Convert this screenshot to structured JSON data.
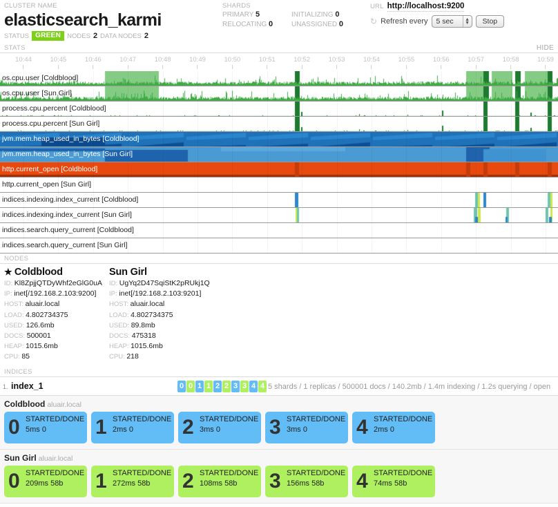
{
  "header": {
    "cluster_label": "CLUSTER NAME",
    "cluster_name": "elasticsearch_karmi",
    "status_label": "STATUS",
    "status_value": "GREEN",
    "status_color": "#7cd116",
    "nodes_label": "NODES",
    "nodes_value": "2",
    "data_nodes_label": "DATA NODES",
    "data_nodes_value": "2",
    "shards_label": "SHARDS",
    "shards": [
      {
        "label": "PRIMARY",
        "value": "5"
      },
      {
        "label": "INITIALIZING",
        "value": "0"
      },
      {
        "label": "RELOCATING",
        "value": "0"
      },
      {
        "label": "UNASSIGNED",
        "value": "0"
      }
    ],
    "url_label": "URL",
    "url_value": "http://localhost:9200",
    "refresh_icon": "refresh-icon",
    "refresh_label": "Refresh every",
    "refresh_interval": "5 sec",
    "stop_label": "Stop"
  },
  "stats": {
    "section_label": "STATS",
    "hide_label": "Hide",
    "ticks": [
      "10:44",
      "10:45",
      "10:46",
      "10:47",
      "10:48",
      "10:49",
      "10:50",
      "10:51",
      "10:52",
      "10:53",
      "10:54",
      "10:55",
      "10:56",
      "10:57",
      "10:58",
      "10:59"
    ],
    "rows": [
      {
        "label": "os.cpu.user [Coldblood]",
        "color": "#4eb24e",
        "style": "spike",
        "invert": false
      },
      {
        "label": "os.cpu.user [Sun Girl]",
        "color": "#4eb24e",
        "style": "spike",
        "invert": false
      },
      {
        "label": "process.cpu.percent [Coldblood]",
        "color": "#1d7a2f",
        "style": "sparse",
        "invert": false
      },
      {
        "label": "process.cpu.percent [Sun Girl]",
        "color": "#1d7a2f",
        "style": "sparse",
        "invert": false
      },
      {
        "label": "jvm.mem.heap_used_in_bytes [Coldblood]",
        "color": "#1f71b8",
        "style": "saw",
        "invert": true
      },
      {
        "label": "jvm.mem.heap_used_in_bytes [Sun Girl]",
        "color": "#4a9ad4",
        "style": "saw2",
        "invert": true
      },
      {
        "label": "http.current_open [Coldblood]",
        "color": "#e8490f",
        "style": "solid",
        "invert": true
      },
      {
        "label": "http.current_open [Sun Girl]",
        "color": "#e8490f",
        "style": "empty",
        "invert": false
      },
      {
        "label": "indices.indexing.index_current [Coldblood]",
        "color": "#2f86c8",
        "style": "ticks",
        "invert": false
      },
      {
        "label": "indices.indexing.index_current [Sun Girl]",
        "color": "#2f86c8",
        "style": "ticks2",
        "invert": false
      },
      {
        "label": "indices.search.query_current [Coldblood]",
        "color": "#2f86c8",
        "style": "empty",
        "invert": false
      },
      {
        "label": "indices.search.query_current [Sun Girl]",
        "color": "#2f86c8",
        "style": "empty",
        "invert": false
      }
    ]
  },
  "nodes": {
    "section_label": "NODES",
    "keys": [
      "ID",
      "IP",
      "HOST",
      "LOAD",
      "USED",
      "DOCS",
      "HEAP",
      "CPU"
    ],
    "list": [
      {
        "name": "Coldblood",
        "master": true,
        "master_icon": "star-icon",
        "values": [
          "Kl8ZpjjQTDyWhf2eGlG0uA",
          "inet[/192.168.2.103:9200]",
          "aluair.local",
          "4.802734375",
          "126.6mb",
          "500001",
          "1015.6mb",
          "85"
        ]
      },
      {
        "name": "Sun Girl",
        "master": false,
        "values": [
          "UgYq2D47SqiStK2pRUkj1Q",
          "inet[/192.168.2.103:9201]",
          "aluair.local",
          "4.802734375",
          "89.8mb",
          "475318",
          "1015.6mb",
          "218"
        ]
      }
    ]
  },
  "indices": {
    "section_label": "INDICES",
    "list": [
      {
        "number": "1.",
        "name": "index_1",
        "shard_badges": [
          {
            "label": "0",
            "color": "blue"
          },
          {
            "label": "0",
            "color": "green"
          },
          {
            "label": "1",
            "color": "blue"
          },
          {
            "label": "1",
            "color": "green"
          },
          {
            "label": "2",
            "color": "blue"
          },
          {
            "label": "2",
            "color": "green"
          },
          {
            "label": "3",
            "color": "blue"
          },
          {
            "label": "3",
            "color": "green"
          },
          {
            "label": "4",
            "color": "blue"
          },
          {
            "label": "4",
            "color": "green"
          }
        ],
        "meta": "5 shards / 1 replicas / 500001 docs / 140.2mb / 1.4m indexing / 1.2s querying / open"
      }
    ]
  },
  "shard_panels": [
    {
      "node": "Coldblood",
      "host": "aluair.local",
      "color": "blue",
      "cards": [
        {
          "num": "0",
          "state": "STARTED/DONE",
          "detail": "5ms 0"
        },
        {
          "num": "1",
          "state": "STARTED/DONE",
          "detail": "2ms 0"
        },
        {
          "num": "2",
          "state": "STARTED/DONE",
          "detail": "3ms 0"
        },
        {
          "num": "3",
          "state": "STARTED/DONE",
          "detail": "3ms 0"
        },
        {
          "num": "4",
          "state": "STARTED/DONE",
          "detail": "2ms 0"
        }
      ]
    },
    {
      "node": "Sun Girl",
      "host": "aluair.local",
      "color": "green",
      "cards": [
        {
          "num": "0",
          "state": "STARTED/DONE",
          "detail": "209ms 58b"
        },
        {
          "num": "1",
          "state": "STARTED/DONE",
          "detail": "272ms 58b"
        },
        {
          "num": "2",
          "state": "STARTED/DONE",
          "detail": "108ms 58b"
        },
        {
          "num": "3",
          "state": "STARTED/DONE",
          "detail": "156ms 58b"
        },
        {
          "num": "4",
          "state": "STARTED/DONE",
          "detail": "74ms 58b"
        }
      ]
    }
  ]
}
